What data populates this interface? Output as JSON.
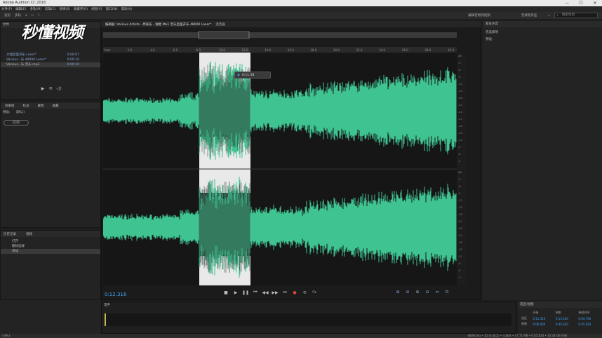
{
  "window": {
    "title": "Adobe Audition CC 2018"
  },
  "menu": [
    "文件(F)",
    "编辑(E)",
    "多轨(M)",
    "剪辑(C)",
    "效果(S)",
    "收藏夹(R)",
    "视图(V)",
    "窗口(W)",
    "帮助(H)"
  ],
  "toolbar": {
    "waveform_label": "波形",
    "multitrack_label": "多轨",
    "workspace_a": "编辑音频到视频",
    "workspace_b": "无线电作品",
    "search_placeholder": "搜索帮助"
  },
  "watermark": {
    "text": "秒懂视频"
  },
  "files_panel": {
    "tab": "文件",
    "items": [
      {
        "name": "大拙后里开乐 Loser*",
        "duration": "0:00:07"
      },
      {
        "name": "Various...乐 48000 Loser*",
        "duration": "0:00:10"
      },
      {
        "name": "Various...乐 音乐.mp3",
        "duration": "0:00:10"
      }
    ]
  },
  "effects_panel": {
    "tabs": [
      "效果组",
      "标记",
      "属性",
      "收藏"
    ],
    "preset_label": "预设:",
    "preset_value": "(默认)",
    "apply_label": "应用"
  },
  "history_panel": {
    "tabs": [
      "历史记录",
      "视频"
    ],
    "items": [
      "打开",
      "删除选择",
      "添加"
    ]
  },
  "editor": {
    "tabs": [
      "编辑器: Various Artists - 周某乐 - 独唱 Mo1 音乐后里开乐 48000 Loser*",
      "混音器"
    ],
    "time_display": "0:12.316",
    "selection_tooltip": "0:11.58",
    "ruler_labels": [
      "hms",
      "2.0",
      "4.0",
      "6.0",
      "8.0",
      "10.0",
      "12.0",
      "14.0",
      "16.0",
      "18.0",
      "20.0",
      "22.0",
      "24.0",
      "26.0",
      "28.0",
      "30.0"
    ],
    "db_labels": [
      "dB",
      "-3",
      "-6",
      "-9",
      "-12",
      "-15",
      "-18",
      "-21",
      "-24",
      "-21",
      "-18",
      "-15",
      "-12",
      "-9",
      "-6",
      "-3"
    ]
  },
  "transport": {
    "icons": [
      "stop-icon",
      "play-icon",
      "pause-icon",
      "go-start-icon",
      "rewind-icon",
      "fast-forward-icon",
      "go-end-icon",
      "record-icon",
      "loop-icon",
      "skip-icon"
    ]
  },
  "right_panel": {
    "title": "基本声音",
    "subtitle": "无选择项",
    "label": "预设:"
  },
  "mixer": {
    "title": "电平"
  },
  "selection_view": {
    "title": "选区/视图",
    "headers": [
      "",
      "开始",
      "结束",
      "持续时间"
    ],
    "rows": [
      {
        "label": "选区",
        "start": "0:11.316",
        "end": "0:13.320",
        "duration": "0:04.792"
      },
      {
        "label": "视图",
        "start": "0:00.000",
        "end": "0:45.620",
        "duration": "0:45.620"
      }
    ]
  },
  "status_bar": {
    "left": "已停止",
    "right": "48000 Hz • 32 位(浮点) • 立体声 • 17.71 MB • 0:45.620 • 33.43 GB 空闲"
  },
  "colors": {
    "waveform": "#3ec391",
    "selection": "#ffffff",
    "accent": "#3ea6ff",
    "background": "#161616"
  }
}
